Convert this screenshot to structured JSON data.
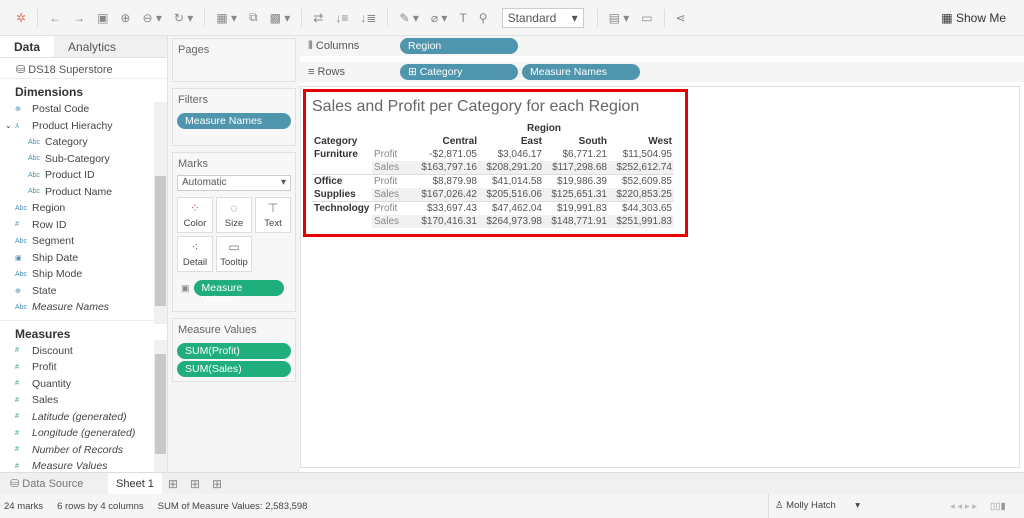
{
  "toolbar": {
    "standard": "Standard",
    "show_me": "Show Me"
  },
  "data_pane": {
    "tab_data": "Data",
    "tab_analytics": "Analytics",
    "datasource": "DS18 Superstore",
    "dimensions_title": "Dimensions",
    "dimensions": [
      {
        "label": "Postal Code",
        "icon": "globe-icon",
        "sub": false,
        "italic": false
      },
      {
        "label": "Product Hierachy",
        "icon": "hierarchy-icon",
        "sub": false,
        "italic": false
      },
      {
        "label": "Category",
        "icon": "abc-icon",
        "sub": true,
        "italic": false
      },
      {
        "label": "Sub-Category",
        "icon": "abc-icon",
        "sub": true,
        "italic": false
      },
      {
        "label": "Product ID",
        "icon": "abc-icon",
        "sub": true,
        "italic": false
      },
      {
        "label": "Product Name",
        "icon": "abc-icon",
        "sub": true,
        "italic": false
      },
      {
        "label": "Region",
        "icon": "abc-icon",
        "sub": false,
        "italic": false
      },
      {
        "label": "Row ID",
        "icon": "number-icon",
        "sub": false,
        "italic": false
      },
      {
        "label": "Segment",
        "icon": "abc-icon",
        "sub": false,
        "italic": false
      },
      {
        "label": "Ship Date",
        "icon": "calendar-icon",
        "sub": false,
        "italic": false
      },
      {
        "label": "Ship Mode",
        "icon": "abc-icon",
        "sub": false,
        "italic": false
      },
      {
        "label": "State",
        "icon": "globe-icon",
        "sub": false,
        "italic": false
      },
      {
        "label": "Measure Names",
        "icon": "abc-icon",
        "sub": false,
        "italic": true
      }
    ],
    "measures_title": "Measures",
    "measures": [
      {
        "label": "Discount",
        "italic": false
      },
      {
        "label": "Profit",
        "italic": false
      },
      {
        "label": "Quantity",
        "italic": false
      },
      {
        "label": "Sales",
        "italic": false
      },
      {
        "label": "Latitude (generated)",
        "italic": true
      },
      {
        "label": "Longitude (generated)",
        "italic": true
      },
      {
        "label": "Number of Records",
        "italic": true
      },
      {
        "label": "Measure Values",
        "italic": true
      }
    ]
  },
  "cards": {
    "pages": "Pages",
    "filters": "Filters",
    "filter_pill": "Measure Names",
    "marks": "Marks",
    "mark_type": "Automatic",
    "mark_buttons": [
      "Color",
      "Size",
      "Text",
      "Detail",
      "Tooltip"
    ],
    "marks_pill": "Measure Values",
    "measure_values": "Measure Values",
    "mv_pills": [
      "SUM(Profit)",
      "SUM(Sales)"
    ]
  },
  "shelves": {
    "columns": "Columns",
    "columns_pill": "Region",
    "rows": "Rows",
    "rows_pills": [
      "Category",
      "Measure Names"
    ]
  },
  "view": {
    "title": "Sales and Profit per Category for each Region",
    "region_header": "Region",
    "category_header": "Category",
    "columns": [
      "Central",
      "East",
      "South",
      "West"
    ],
    "groups": [
      {
        "category": [
          "Furniture"
        ],
        "rows": [
          {
            "measure": "Profit",
            "values": [
              "-$2,871.05",
              "$3,046.17",
              "$6,771.21",
              "$11,504.95"
            ]
          },
          {
            "measure": "Sales",
            "values": [
              "$163,797.16",
              "$208,291.20",
              "$117,298.68",
              "$252,612.74"
            ]
          }
        ]
      },
      {
        "category": [
          "Office",
          "Supplies"
        ],
        "rows": [
          {
            "measure": "Profit",
            "values": [
              "$8,879.98",
              "$41,014.58",
              "$19,986.39",
              "$52,609.85"
            ]
          },
          {
            "measure": "Sales",
            "values": [
              "$167,026.42",
              "$205,516.06",
              "$125,651.31",
              "$220,853.25"
            ]
          }
        ]
      },
      {
        "category": [
          "Technology"
        ],
        "rows": [
          {
            "measure": "Profit",
            "values": [
              "$33,697.43",
              "$47,462.04",
              "$19,991.83",
              "$44,303.65"
            ]
          },
          {
            "measure": "Sales",
            "values": [
              "$170,416.31",
              "$264,973.98",
              "$148,771.91",
              "$251,991.83"
            ]
          }
        ]
      }
    ]
  },
  "sheet_tabs": {
    "data_source": "Data Source",
    "sheet": "Sheet 1"
  },
  "status": {
    "marks": "24 marks",
    "dims": "6 rows by 4 columns",
    "sum": "SUM of Measure Values: 2,583,598",
    "user": "Molly Hatch"
  },
  "colors": {
    "accent_blue": "#4f95ad",
    "accent_green": "#1fae7c",
    "highlight": "#e80000"
  }
}
